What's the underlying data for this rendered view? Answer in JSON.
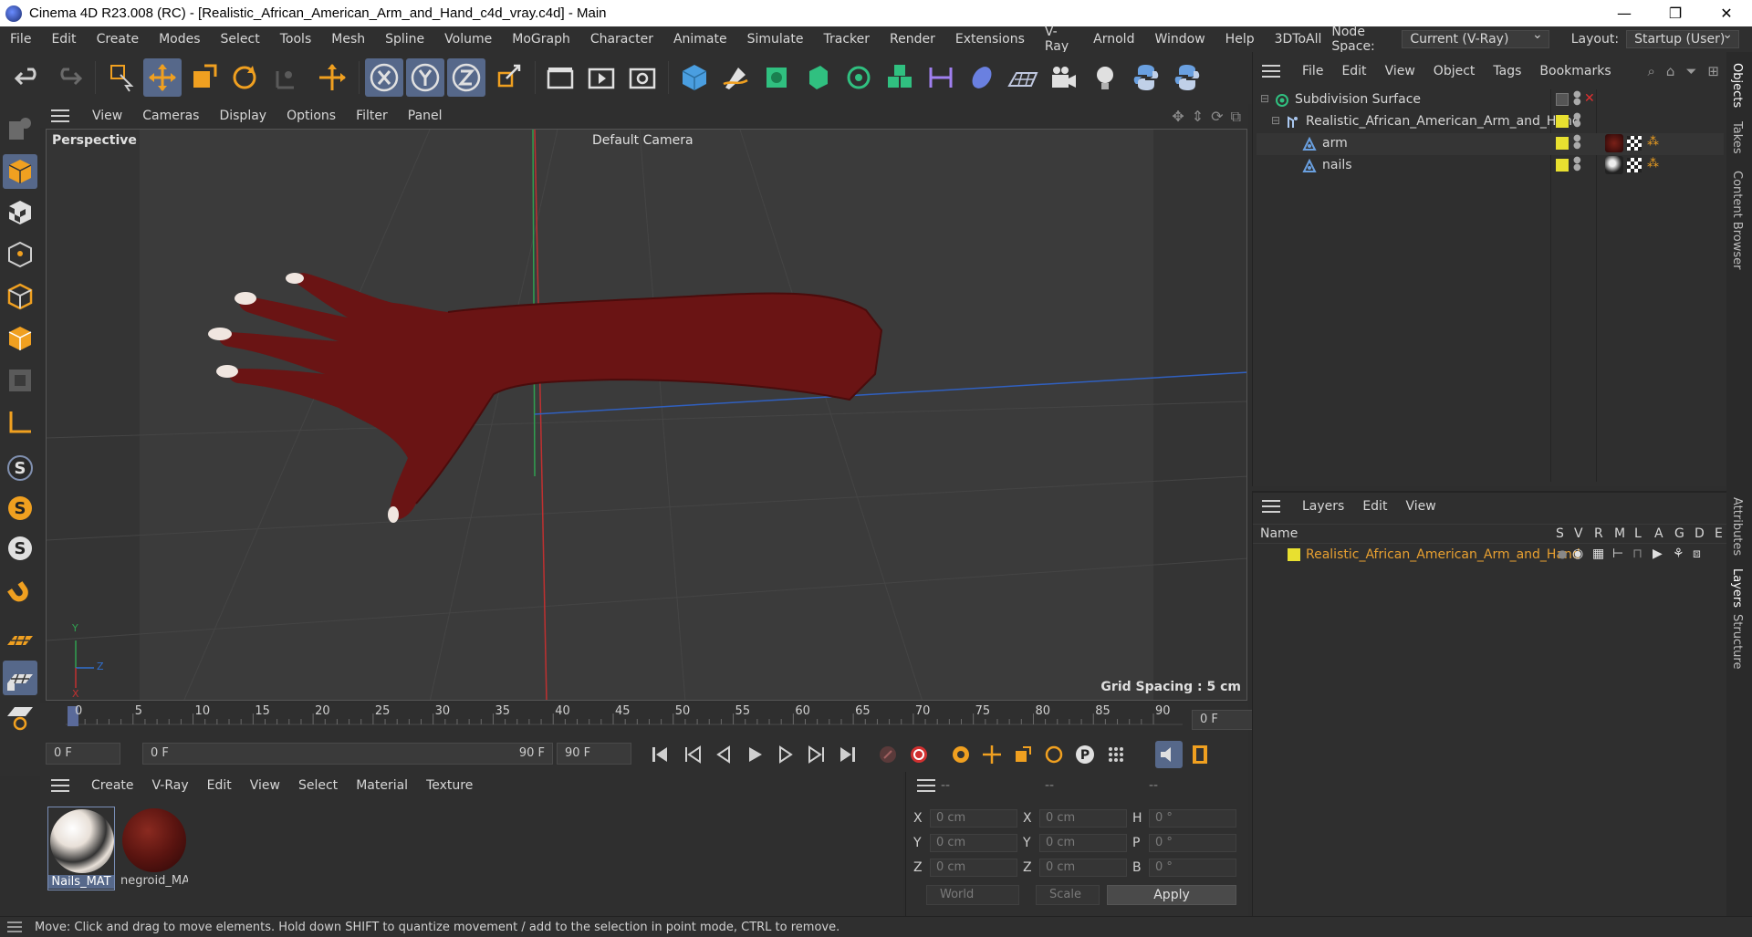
{
  "window": {
    "title": "Cinema 4D R23.008 (RC) - [Realistic_African_American_Arm_and_Hand_c4d_vray.c4d] - Main",
    "controls": [
      "—",
      "❐",
      "✕"
    ]
  },
  "menubar": {
    "items": [
      "File",
      "Edit",
      "Create",
      "Modes",
      "Select",
      "Tools",
      "Mesh",
      "Spline",
      "Volume",
      "MoGraph",
      "Character",
      "Animate",
      "Simulate",
      "Tracker",
      "Render",
      "Extensions",
      "V-Ray",
      "Arnold",
      "Window",
      "Help",
      "3DToAll"
    ],
    "node_space_label": "Node Space:",
    "node_space_value": "Current (V-Ray)",
    "layout_label": "Layout:",
    "layout_value": "Startup (User)"
  },
  "viewport": {
    "menu": [
      "View",
      "Cameras",
      "Display",
      "Options",
      "Filter",
      "Panel"
    ],
    "label": "Perspective",
    "camera": "Default Camera",
    "grid_spacing": "Grid Spacing : 5 cm",
    "axis_labels": {
      "y": "Y",
      "z": "Z",
      "x": "X"
    }
  },
  "timeline": {
    "ticks": [
      "0",
      "5",
      "10",
      "15",
      "20",
      "25",
      "30",
      "35",
      "40",
      "45",
      "50",
      "55",
      "60",
      "65",
      "70",
      "75",
      "80",
      "85",
      "90"
    ],
    "current_frame": "0 F"
  },
  "transport": {
    "start_field": "0 F",
    "range_start": "0 F",
    "range_end": "90 F",
    "end_field": "90 F"
  },
  "material_panel": {
    "menu": [
      "Create",
      "V-Ray",
      "Edit",
      "View",
      "Select",
      "Material",
      "Texture"
    ],
    "materials": [
      {
        "name": "Nails_MAT",
        "selected": true
      },
      {
        "name": "negroid_MA",
        "selected": false
      }
    ]
  },
  "coords": {
    "headers": [
      "--",
      "--",
      "--"
    ],
    "rows": [
      {
        "l1": "X",
        "v1": "0 cm",
        "l2": "X",
        "v2": "0 cm",
        "l3": "H",
        "v3": "0 °"
      },
      {
        "l1": "Y",
        "v1": "0 cm",
        "l2": "Y",
        "v2": "0 cm",
        "l3": "P",
        "v3": "0 °"
      },
      {
        "l1": "Z",
        "v1": "0 cm",
        "l2": "Z",
        "v2": "0 cm",
        "l3": "B",
        "v3": "0 °"
      }
    ],
    "space": "World",
    "mode": "Scale",
    "apply": "Apply"
  },
  "object_manager": {
    "menu": [
      "File",
      "Edit",
      "View",
      "Object",
      "Tags",
      "Bookmarks"
    ],
    "objects": [
      {
        "name": "Subdivision Surface",
        "indent": 0
      },
      {
        "name": "Realistic_African_American_Arm_and_Hand",
        "indent": 1
      },
      {
        "name": "arm",
        "indent": 2
      },
      {
        "name": "nails",
        "indent": 2
      }
    ]
  },
  "layers": {
    "menu": [
      "Layers",
      "Edit",
      "View"
    ],
    "columns": [
      "Name",
      "S",
      "V",
      "R",
      "M",
      "L",
      "A",
      "G",
      "D",
      "E"
    ],
    "rows": [
      {
        "name": "Realistic_African_American_Arm_and_Hand"
      }
    ]
  },
  "right_tabs": [
    "Objects",
    "Takes",
    "Content Browser",
    "Attributes",
    "Layers",
    "Structure"
  ],
  "status": {
    "message": "Move: Click and drag to move elements. Hold down SHIFT to quantize movement / add to the selection in point mode, CTRL to remove."
  },
  "colors": {
    "accent": "#56688a",
    "layer_yellow": "#e8e030",
    "layer_name": "#e8a030",
    "skin": "#6e1414"
  }
}
